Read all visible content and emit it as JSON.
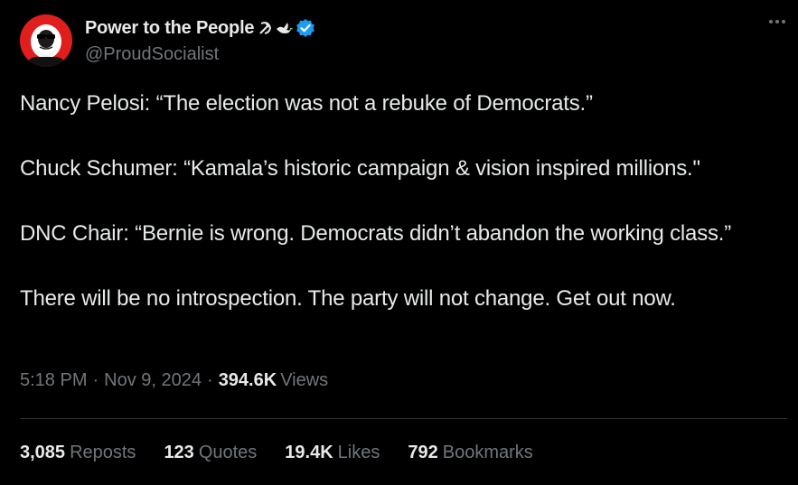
{
  "author": {
    "display_name": "Power to the People",
    "handle": "@ProudSocialist",
    "name_emojis": [
      "hammer-sickle-icon",
      "dove-icon"
    ],
    "verified": true,
    "verified_color": "#1d9bf0",
    "avatar_bg": "#e01e1e"
  },
  "tweet": {
    "paragraphs": [
      "Nancy Pelosi: “The election was not a rebuke of Democrats.”",
      "Chuck Schumer: “Kamala’s historic campaign & vision inspired millions.\"",
      "DNC Chair: “Bernie is wrong. Democrats didn’t abandon the working class.”",
      "There will be no introspection. The party will not change. Get out now."
    ]
  },
  "meta": {
    "time": "5:18 PM",
    "separator": "·",
    "date": "Nov 9, 2024",
    "views_count": "394.6K",
    "views_label": "Views"
  },
  "stats": {
    "reposts": {
      "count": "3,085",
      "label": "Reposts"
    },
    "quotes": {
      "count": "123",
      "label": "Quotes"
    },
    "likes": {
      "count": "19.4K",
      "label": "Likes"
    },
    "bookmarks": {
      "count": "792",
      "label": "Bookmarks"
    }
  },
  "colors": {
    "background": "#000000",
    "text_primary": "#e7e9ea",
    "text_secondary": "#71767b",
    "divider": "#2f3336"
  }
}
